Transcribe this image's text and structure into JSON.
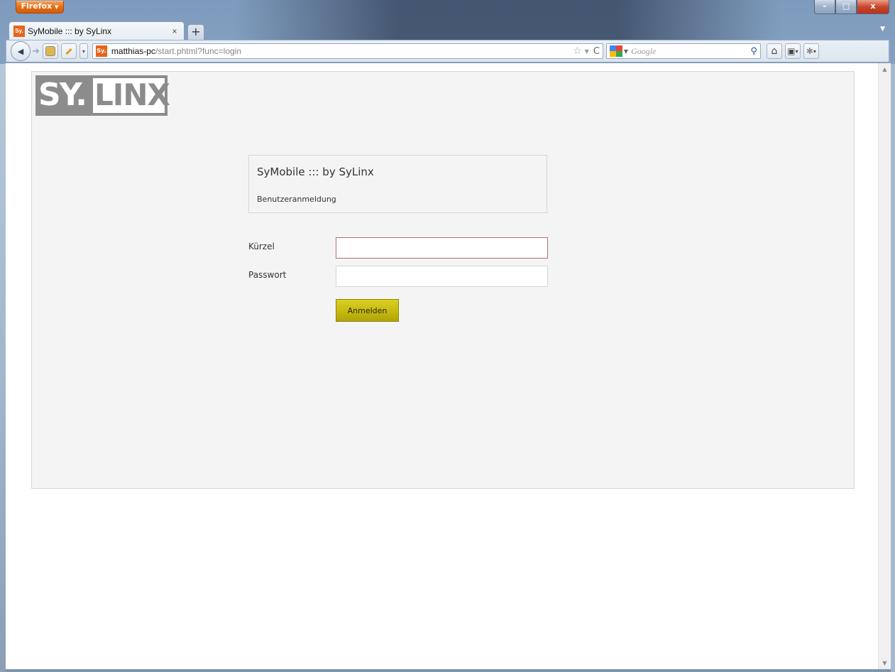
{
  "browser": {
    "menu_button_label": "Firefox",
    "menu_button_arrow": "▼",
    "window_buttons": {
      "minimize": "–",
      "maximize": "□",
      "close": "x"
    },
    "tab": {
      "favicon_text": "Sy.",
      "title": "SyMobile ::: by SyLinx",
      "close_glyph": "×"
    },
    "new_tab_glyph": "+",
    "tab_menu_glyph": "▼",
    "nav": {
      "back_glyph": "◀",
      "forward_glyph": "➜",
      "url_favicon_text": "Sy.",
      "url_host": "matthias-pc",
      "url_path": "/start.phtml?func=login",
      "bookmark_star_glyph": "☆",
      "url_dropdown_glyph": "▼",
      "reload_glyph": "C",
      "search_placeholder": "Google",
      "search_dropdown_glyph": "▼",
      "search_go_glyph": "⚲",
      "home_glyph": "⌂",
      "bookmarks_glyph": "▣",
      "addons_glyph": "✱",
      "dropdown_glyph": "▾"
    },
    "scrollbar": {
      "up_glyph": "▲",
      "down_glyph": "▼"
    },
    "icons": {
      "menu": "firefox-menu-icon",
      "back": "back-arrow-icon",
      "forward": "forward-arrow-icon",
      "star": "bookmark-star-icon",
      "reload": "reload-icon",
      "search": "magnifier-icon",
      "home": "home-icon"
    },
    "colors": {
      "firefox_orange": "#e36c15",
      "google_blue": "#4285f4",
      "google_red": "#ea4335",
      "google_yellow": "#fbbc05",
      "google_green": "#34a853"
    }
  },
  "page": {
    "logo": {
      "left_text": "SY.",
      "right_text": "LINX"
    },
    "title": "SyMobile ::: by SyLinx",
    "subtitle": "Benutzeranmeldung",
    "form": {
      "username_label": "Kürzel",
      "username_value": "",
      "password_label": "Passwort",
      "password_value": "",
      "submit_label": "Anmelden"
    },
    "colors": {
      "page_background": "#f4f4f4",
      "border": "#d6d6d6",
      "logo_gray": "#8c8c8c",
      "button_yellow": "#c5b912",
      "focus_border": "#b0716a"
    }
  }
}
